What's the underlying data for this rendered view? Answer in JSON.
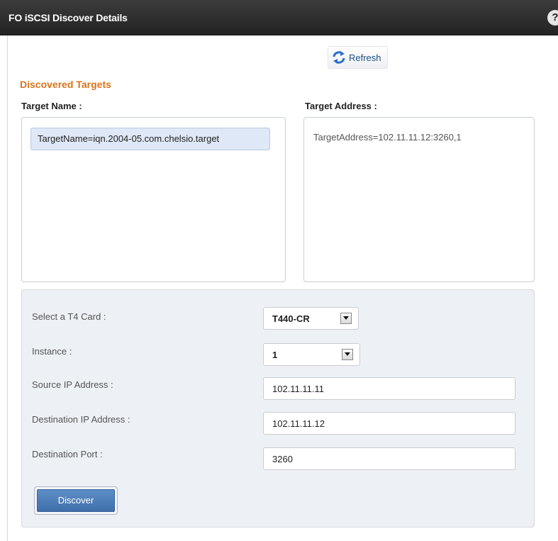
{
  "window": {
    "title": "FO iSCSI Discover Details",
    "help_label": "?"
  },
  "toolbar": {
    "refresh_label": "Refresh",
    "refresh_icon": "refresh-icon"
  },
  "discovered": {
    "heading": "Discovered Targets",
    "target_name_label": "Target Name :",
    "target_address_label": "Target Address :",
    "target_names": [
      "TargetName=iqn.2004-05.com.chelsio.target"
    ],
    "target_addresses": [
      "TargetAddress=102.11.11.12:3260,1"
    ]
  },
  "form": {
    "card": {
      "label": "Select a T4 Card :",
      "value": "T440-CR"
    },
    "instance": {
      "label": "Instance :",
      "value": "1"
    },
    "source_ip": {
      "label": "Source IP Address :",
      "value": "102.11.11.11"
    },
    "dest_ip": {
      "label": "Destination IP Address :",
      "value": "102.11.11.12"
    },
    "dest_port": {
      "label": "Destination Port :",
      "value": "3260"
    },
    "discover_label": "Discover"
  },
  "colors": {
    "title_bar": "#2b2b2b",
    "heading_accent": "#d9741b",
    "selected_item": "#dfe8f6",
    "primary_button": "#4a7ab5",
    "panel_bg": "#edf0f4"
  }
}
